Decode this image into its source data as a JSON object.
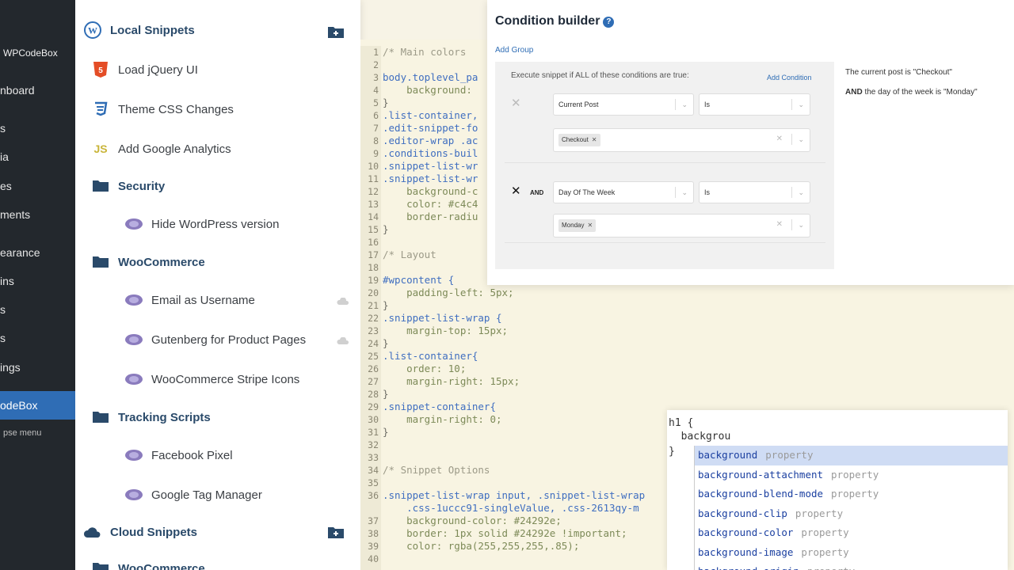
{
  "wp_sidebar": {
    "brand": "WPCodeBox",
    "items": [
      "nboard",
      "s",
      "ia",
      "es",
      "ments",
      "earance",
      "ins",
      "s",
      "s",
      "ings"
    ],
    "active": "odeBox",
    "collapse": "pse menu"
  },
  "snippets": {
    "local_header": "Local Snippets",
    "cloud_header": "Cloud Snippets",
    "items": [
      {
        "label": "Load jQuery UI",
        "icon": "html5-icon"
      },
      {
        "label": "Theme CSS Changes",
        "icon": "css3-icon"
      },
      {
        "label": "Add Google Analytics",
        "icon": "js-icon",
        "icon_text": "JS"
      },
      {
        "label": "Security",
        "icon": "folder-icon",
        "folder": true
      },
      {
        "label": "Hide WordPress version",
        "icon": "php-icon"
      },
      {
        "label": "WooCommerce",
        "icon": "folder-icon",
        "folder": true
      },
      {
        "label": "Email as Username",
        "icon": "php-icon"
      },
      {
        "label": "Gutenberg for Product Pages",
        "icon": "php-icon"
      },
      {
        "label": "WooCommerce Stripe Icons",
        "icon": "php-icon"
      },
      {
        "label": "Tracking Scripts",
        "icon": "folder-icon",
        "folder": true
      },
      {
        "label": "Facebook Pixel",
        "icon": "php-icon"
      },
      {
        "label": "Google Tag Manager",
        "icon": "php-icon"
      }
    ],
    "cloud_folder": "WooCommerce"
  },
  "editor": {
    "lines": [
      {
        "n": "1",
        "t": "/* Main colors",
        "c": "com"
      },
      {
        "n": "2",
        "t": "",
        "c": "txt"
      },
      {
        "n": "3",
        "t": "body.toplevel_pa",
        "c": "sel"
      },
      {
        "n": "4",
        "t": "    background:",
        "c": "prop"
      },
      {
        "n": "5",
        "t": "}",
        "c": "txt"
      },
      {
        "n": "6",
        "t": ".list-container,",
        "c": "sel"
      },
      {
        "n": "7",
        "t": ".edit-snippet-fo",
        "c": "sel"
      },
      {
        "n": "8",
        "t": ".editor-wrap .ac",
        "c": "sel"
      },
      {
        "n": "9",
        "t": ".conditions-buil",
        "c": "sel"
      },
      {
        "n": "10",
        "t": ".snippet-list-wr",
        "c": "sel"
      },
      {
        "n": "11",
        "t": ".snippet-list-wr",
        "c": "sel"
      },
      {
        "n": "12",
        "t": "    background-c",
        "c": "prop"
      },
      {
        "n": "13",
        "t": "    color: #c4c4",
        "c": "prop"
      },
      {
        "n": "14",
        "t": "    border-radiu",
        "c": "prop"
      },
      {
        "n": "15",
        "t": "}",
        "c": "txt"
      },
      {
        "n": "16",
        "t": "",
        "c": "txt"
      },
      {
        "n": "17",
        "t": "/* Layout",
        "c": "com"
      },
      {
        "n": "18",
        "t": "",
        "c": "txt"
      },
      {
        "n": "19",
        "t": "#wpcontent {",
        "c": "sel"
      },
      {
        "n": "20",
        "t": "    padding-left: 5px;",
        "c": "prop"
      },
      {
        "n": "21",
        "t": "}",
        "c": "txt"
      },
      {
        "n": "22",
        "t": ".snippet-list-wrap {",
        "c": "sel"
      },
      {
        "n": "23",
        "t": "    margin-top: 15px;",
        "c": "prop"
      },
      {
        "n": "24",
        "t": "}",
        "c": "txt"
      },
      {
        "n": "25",
        "t": ".list-container{",
        "c": "sel"
      },
      {
        "n": "26",
        "t": "    order: 10;",
        "c": "prop"
      },
      {
        "n": "27",
        "t": "    margin-right: 15px;",
        "c": "prop"
      },
      {
        "n": "28",
        "t": "}",
        "c": "txt"
      },
      {
        "n": "29",
        "t": ".snippet-container{",
        "c": "sel"
      },
      {
        "n": "30",
        "t": "    margin-right: 0;",
        "c": "prop"
      },
      {
        "n": "31",
        "t": "}",
        "c": "txt"
      },
      {
        "n": "32",
        "t": "",
        "c": "txt"
      },
      {
        "n": "33",
        "t": "",
        "c": "txt"
      },
      {
        "n": "34",
        "t": "/* Snippet Options",
        "c": "com"
      },
      {
        "n": "35",
        "t": "",
        "c": "txt"
      },
      {
        "n": "36",
        "t": ".snippet-list-wrap input, .snippet-list-wrap",
        "c": "sel"
      },
      {
        "n": "",
        "t": "    .css-1uccc91-singleValue, .css-2613qy-m",
        "c": "sel"
      },
      {
        "n": "37",
        "t": "    background-color: #24292e;",
        "c": "prop"
      },
      {
        "n": "38",
        "t": "    border: 1px solid #24292e !important;",
        "c": "prop"
      },
      {
        "n": "39",
        "t": "    color: rgba(255,255,255,.85);",
        "c": "prop"
      },
      {
        "n": "40",
        "t": "",
        "c": "txt"
      }
    ]
  },
  "condition_builder": {
    "title": "Condition builder",
    "help_icon": "?",
    "add_group": "Add Group",
    "execute_text": "Execute snippet if ALL of these conditions are true:",
    "add_condition": "Add Condition",
    "conditions": [
      {
        "field": "Current Post",
        "operator": "Is",
        "value": "Checkout",
        "conjunction": ""
      },
      {
        "field": "Day Of The Week",
        "operator": "Is",
        "value": "Monday",
        "conjunction": "AND"
      }
    ],
    "summary_1": "The current post is \"Checkout\"",
    "summary_2_and": "AND",
    "summary_2": " the day of the week is \"Monday\""
  },
  "autocomplete": {
    "line1": "h1 {",
    "line2": "  backgrou",
    "line3": "}",
    "suggestions": [
      {
        "name": "background",
        "kind": "property"
      },
      {
        "name": "background-attachment",
        "kind": "property"
      },
      {
        "name": "background-blend-mode",
        "kind": "property"
      },
      {
        "name": "background-clip",
        "kind": "property"
      },
      {
        "name": "background-color",
        "kind": "property"
      },
      {
        "name": "background-image",
        "kind": "property"
      },
      {
        "name": "background-origin",
        "kind": "property"
      }
    ]
  },
  "colors": {
    "accent": "#2f6db5",
    "wp_dark": "#23282d",
    "editor_bg": "#f8f4e2"
  }
}
